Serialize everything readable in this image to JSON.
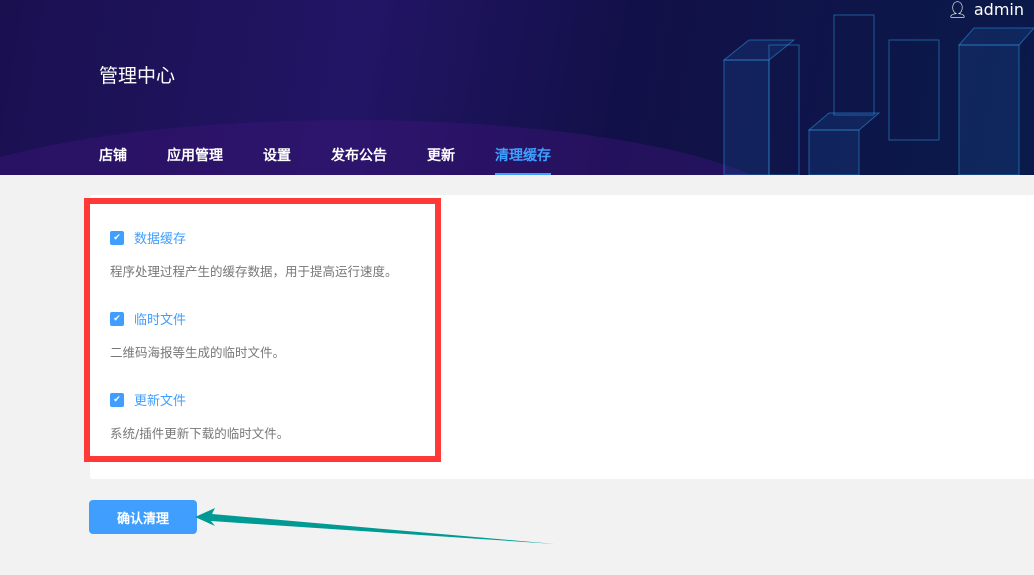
{
  "header": {
    "title": "管理中心",
    "user": "admin"
  },
  "nav": [
    {
      "label": "店铺"
    },
    {
      "label": "应用管理"
    },
    {
      "label": "设置"
    },
    {
      "label": "发布公告"
    },
    {
      "label": "更新"
    },
    {
      "label": "清理缓存"
    }
  ],
  "options": [
    {
      "label": "数据缓存",
      "desc": "程序处理过程产生的缓存数据，用于提高运行速度。",
      "checked": true
    },
    {
      "label": "临时文件",
      "desc": "二维码海报等生成的临时文件。",
      "checked": true
    },
    {
      "label": "更新文件",
      "desc": "系统/插件更新下载的临时文件。",
      "checked": true
    }
  ],
  "confirm_label": "确认清理",
  "colors": {
    "accent": "#409eff",
    "highlight": "#ff3838",
    "arrow": "#009a94"
  }
}
